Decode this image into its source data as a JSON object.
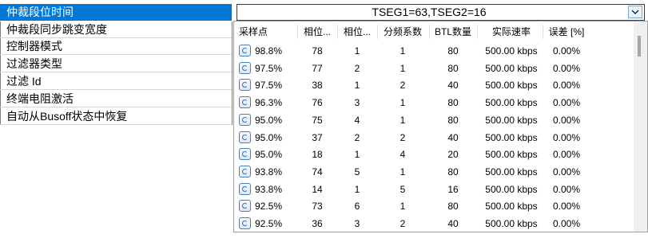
{
  "properties": [
    "仲裁段位时间",
    "仲裁段同步跳变宽度",
    "控制器模式",
    "过滤器类型",
    "过滤 Id",
    "终端电阻激活",
    "自动从Busoff状态中恢复"
  ],
  "combo": {
    "value": "TSEG1=63,TSEG2=16"
  },
  "table": {
    "headers": [
      "采样点",
      "相位...",
      "相位...",
      "分频系数",
      "BTL数量",
      "实际速率",
      "误差 [%]"
    ],
    "rows": [
      [
        "98.8%",
        "78",
        "1",
        "1",
        "80",
        "500.00 kbps",
        "0.00%"
      ],
      [
        "97.5%",
        "77",
        "2",
        "1",
        "80",
        "500.00 kbps",
        "0.00%"
      ],
      [
        "97.5%",
        "38",
        "1",
        "2",
        "40",
        "500.00 kbps",
        "0.00%"
      ],
      [
        "96.3%",
        "76",
        "3",
        "1",
        "80",
        "500.00 kbps",
        "0.00%"
      ],
      [
        "95.0%",
        "75",
        "4",
        "1",
        "80",
        "500.00 kbps",
        "0.00%"
      ],
      [
        "95.0%",
        "37",
        "2",
        "2",
        "40",
        "500.00 kbps",
        "0.00%"
      ],
      [
        "95.0%",
        "18",
        "1",
        "4",
        "20",
        "500.00 kbps",
        "0.00%"
      ],
      [
        "93.8%",
        "74",
        "5",
        "1",
        "80",
        "500.00 kbps",
        "0.00%"
      ],
      [
        "93.8%",
        "14",
        "1",
        "5",
        "16",
        "500.00 kbps",
        "0.00%"
      ],
      [
        "92.5%",
        "73",
        "6",
        "1",
        "80",
        "500.00 kbps",
        "0.00%"
      ],
      [
        "92.5%",
        "36",
        "3",
        "2",
        "40",
        "500.00 kbps",
        "0.00%"
      ]
    ]
  },
  "icons": {
    "row": "refresh-icon",
    "combo_button": "chevron-down-icon"
  },
  "colors": {
    "selection": "#0078d7",
    "border": "#a0a0a0",
    "icon": "#2f6fb5"
  }
}
